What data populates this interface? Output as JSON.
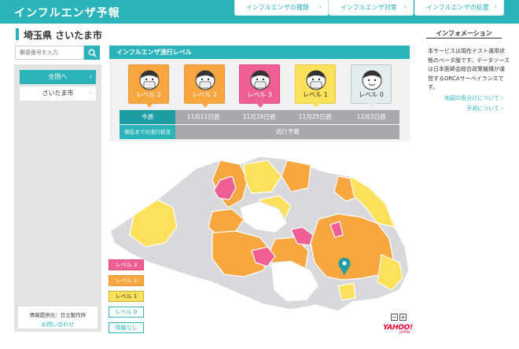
{
  "app": {
    "title": "インフルエンザ予報"
  },
  "header": {
    "nav": [
      {
        "label": "インフルエンザの種類"
      },
      {
        "label": "インフルエンザ対策"
      },
      {
        "label": "インフルエンザの処置"
      }
    ]
  },
  "location": {
    "title": "埼玉県 さいたま市"
  },
  "search": {
    "placeholder": "郵便番号を入力"
  },
  "sidebar": {
    "country_label": "全国へ",
    "city_label": "さいたま市",
    "provider_label": "情報提供元：日立製作所",
    "contact_label": "お問い合わせ"
  },
  "level_panel": {
    "title": "インフルエンザ流行レベル",
    "cards": [
      {
        "label": "レベル 2",
        "color": "#f8a740"
      },
      {
        "label": "レベル 2",
        "color": "#f8a740"
      },
      {
        "label": "レベル 3",
        "color": "#ef5f93"
      },
      {
        "label": "レベル 1",
        "color": "#fde15a"
      },
      {
        "label": "レベル 0",
        "color": "#e4eded"
      }
    ],
    "weeks": [
      {
        "label": "今週"
      },
      {
        "label": "11月11日週"
      },
      {
        "label": "11月18日週"
      },
      {
        "label": "11月25日週"
      },
      {
        "label": "12月2日週"
      }
    ],
    "status_current": "現在までの流行状況",
    "status_forecast": "流行予報"
  },
  "legend": [
    {
      "label": "レベル 3",
      "color": "#ef5f93"
    },
    {
      "label": "レベル 2",
      "color": "#f8a740"
    },
    {
      "label": "レベル 1",
      "color": "#fde15a"
    },
    {
      "label": "レベル 0",
      "color": "#ffffff"
    },
    {
      "label": "情報なし",
      "color": "#ffffff"
    }
  ],
  "map": {
    "zoom_out": "−",
    "zoom_in": "+",
    "logo": "YAHOO!",
    "logo_sub": "JAPAN"
  },
  "info": {
    "title": "インフォメーション",
    "text": "本サービスは現在テスト運用状態のベータ版です。データソースは日本医師会総合政策機構が運営するORCAサーベイランスです。",
    "links": [
      {
        "label": "地図の色分けについて"
      },
      {
        "label": "予測について"
      }
    ]
  },
  "colors": {
    "accent": "#2ab3b9",
    "level3": "#ef5f93",
    "level2": "#f8a740",
    "level1": "#fde15a",
    "nodata": "#d9d9dc"
  }
}
